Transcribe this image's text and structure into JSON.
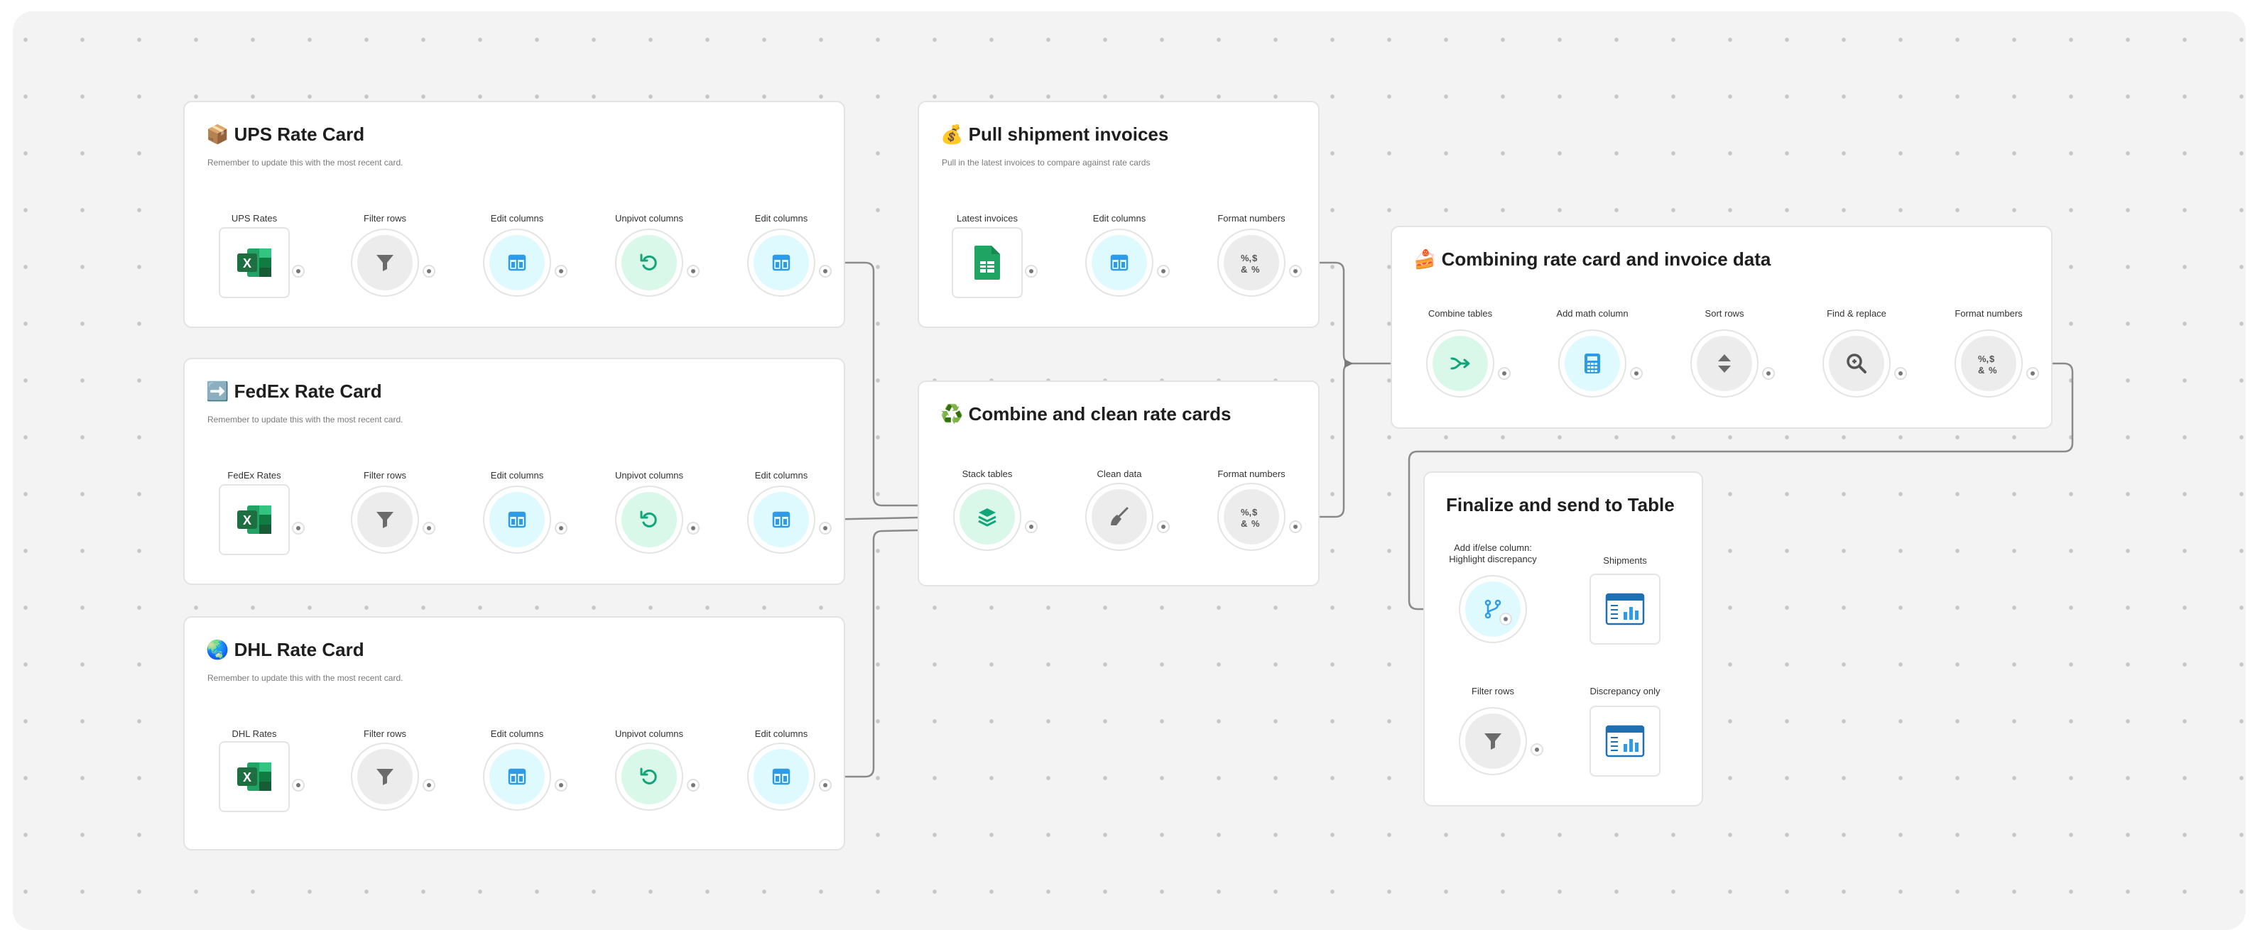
{
  "cards": {
    "ups": {
      "title": "📦 UPS Rate Card",
      "subtitle": "Remember to update this with the most recent card."
    },
    "fedex": {
      "title": "➡️ FedEx Rate Card",
      "subtitle": "Remember to update this with the most recent card."
    },
    "dhl": {
      "title": "🌏 DHL Rate Card",
      "subtitle": "Remember to update this with the most recent card."
    },
    "invoices": {
      "title": "💰 Pull shipment invoices",
      "subtitle": "Pull in the latest invoices to compare against rate cards"
    },
    "combine_clean": {
      "title": "♻️ Combine and clean rate cards",
      "subtitle": ""
    },
    "combining": {
      "title": "🍰 Combining rate card and invoice data",
      "subtitle": ""
    },
    "finalize": {
      "title": "Finalize and send to Table",
      "subtitle": ""
    }
  },
  "nodes": {
    "ups": [
      "UPS Rates",
      "Filter rows",
      "Edit columns",
      "Unpivot columns",
      "Edit columns"
    ],
    "fedex": [
      "FedEx Rates",
      "Filter rows",
      "Edit columns",
      "Unpivot columns",
      "Edit columns"
    ],
    "dhl": [
      "DHL Rates",
      "Filter rows",
      "Edit columns",
      "Unpivot columns",
      "Edit columns"
    ],
    "invoices": [
      "Latest invoices",
      "Edit columns",
      "Format numbers"
    ],
    "combine_clean": [
      "Stack tables",
      "Clean data",
      "Format numbers"
    ],
    "combining": [
      "Combine tables",
      "Add math column",
      "Sort rows",
      "Find & replace",
      "Format numbers"
    ],
    "finalize": [
      "Add if/else column:\nHighlight discrepancy",
      "Shipments",
      "Filter rows",
      "Discrepancy only"
    ]
  },
  "icons": {
    "excel": "excel-icon",
    "sheets": "google-sheets-icon",
    "filter": "filter-icon",
    "edit_columns": "edit-columns-icon",
    "unpivot": "unpivot-icon",
    "format_numbers": "format-numbers-icon",
    "stack": "stack-tables-icon",
    "clean": "broom-icon",
    "combine": "combine-tables-icon",
    "math": "calculator-icon",
    "sort": "sort-icon",
    "find_replace": "find-replace-icon",
    "branch": "branch-icon",
    "table_output": "table-chart-icon"
  },
  "colors": {
    "canvas": "#f3f3f3",
    "excel_green": "#1d6f42",
    "sheets_green": "#1fa463",
    "blue": "#2f9be6",
    "teal": "#12a57a",
    "gray_icon": "#666666"
  }
}
